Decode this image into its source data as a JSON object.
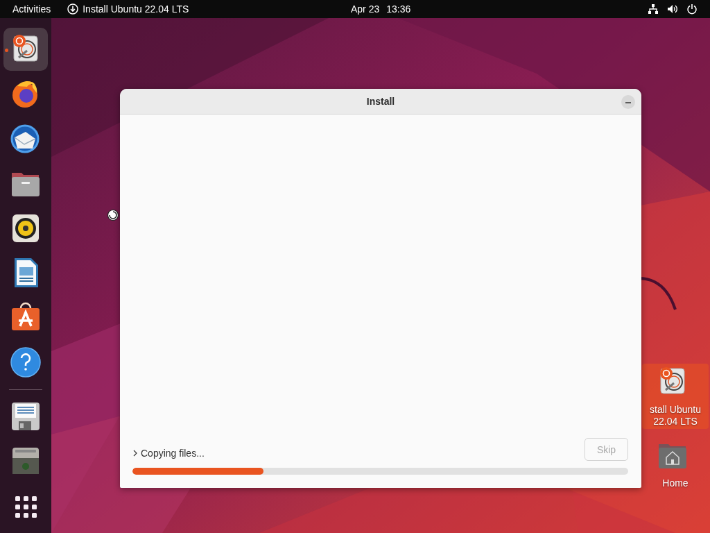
{
  "top_bar": {
    "activities": "Activities",
    "app_menu": "Install Ubuntu 22.04 LTS",
    "date": "Apr 23",
    "time": "13:36"
  },
  "dock": {
    "items": [
      {
        "selected": true,
        "running": true
      },
      {
        "selected": false,
        "running": false
      },
      {
        "selected": false,
        "running": false
      },
      {
        "selected": false,
        "running": false
      },
      {
        "selected": false,
        "running": false
      },
      {
        "selected": false,
        "running": false
      },
      {
        "selected": false,
        "running": false
      },
      {
        "selected": false,
        "running": false
      },
      {
        "selected": false,
        "running": false
      },
      {
        "selected": false,
        "running": false
      }
    ]
  },
  "window": {
    "title": "Install",
    "status": "Copying files...",
    "expanded": false,
    "progress": {
      "level": 0.265
    },
    "skip_button": {
      "label": "Skip",
      "disabled": true
    }
  },
  "desktop_icons": [
    {
      "kind": "installer",
      "lines": [
        "stall Ubuntu",
        "22.04 LTS"
      ],
      "selected": true
    },
    {
      "kind": "home",
      "lines": [
        "Home"
      ],
      "selected": false
    }
  ]
}
